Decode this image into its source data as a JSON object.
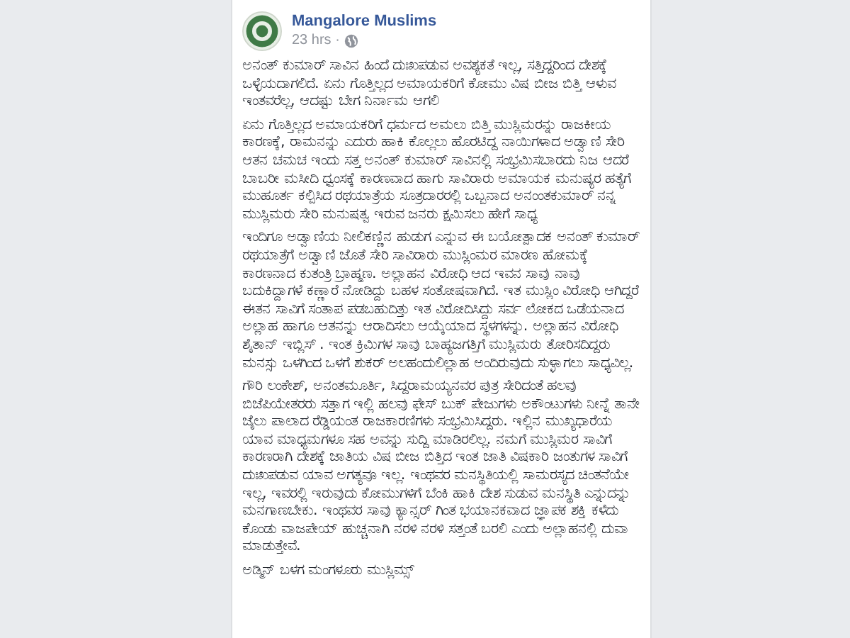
{
  "post": {
    "author": "Mangalore Muslims",
    "time": "23 hrs ·",
    "paragraphs": [
      "ಅನಂತ್ ಕುಮಾರ್ ಸಾವಿನ ಹಿಂದೆ ದುಃಖಪಡುವ ಅವಶ್ಯಕತೆ ಇಲ್ಲ, ಸತ್ತಿದ್ದರಿಂದ ದೇಶಕ್ಕೆ ಒಳ್ಳೆಯದಾಗಲಿದೆ. ಏನು ಗೊತ್ತಿಲ್ಲದ ಅಮಾಯಕರಿಗೆ ಕೋಮು ವಿಷ ಬೀಜ ಬಿತ್ತಿ ಆಳುವ ಇಂತವರೆಲ್ಲ, ಆದಷ್ಟು ಬೇಗ ನಿರ್ನಾಮ ಆಗಲಿ",
      "ಏನು ಗೊತ್ತಿಲ್ಲದ ಅಮಾಯಕರಿಗೆ ಧರ್ಮದ ಅಮಲು ಬಿತ್ತಿ ಮುಸ್ಲಿಮರನ್ನು ರಾಜಕೀಯ ಕಾರಣಕ್ಕೆ, ರಾಮನನ್ನು ಎದುರು ಹಾಕಿ ಕೊಲ್ಲಲು ಹೊರಟಿದ್ದ ನಾಯಿಗಳಾದ ಅಡ್ವಾಣಿ ಸೇರಿ ಆತನ ಚಮಚ ಇಂದು ಸತ್ತ ಅನಂತ್ ಕುಮಾರ್ ಸಾವಿನಲ್ಲಿ ಸಂಭ್ರಮಿಸಬಾರದು ನಿಜ ಆದರೆ ಬಾಬರೀ ಮಸೀದಿ ಧ್ವಂಸಕ್ಕೆ ಕಾರಣವಾದ ಹಾಗು ಸಾವಿರಾರು ಅಮಾಯಕ ಮನುಷ್ಯರ ಹತ್ಯೆಗೆ ಮುಹೂರ್ತ ಕಲ್ಪಿಸಿದ ರಥಯಾತ್ರೆಯ ಸೂತ್ರದಾರರಲ್ಲಿ ಒಬ್ಬನಾದ ಅನಂಂತಕುಮಾರ್ ನನ್ನ ಮುಸ್ಲಿಮರು ಸೇರಿ ಮನುಷತ್ವ ಇರುವ ಜನರು ಕ್ಷಮಿಸಲು ಹೇಗೆ ಸಾಧ್ಯ",
      "ಇಂದಿಗೂ ಅಡ್ವಾಣಿಯ ನೀಲಿಕಣ್ಣಿನ ಹುಡುಗ ಎನ್ನುವ ಈ ಬಯೋತ್ಪಾದಕ ಅನಂತ್ ಕುಮಾರ್ ರಥಯಾತ್ರೆಗೆ ಅಡ್ವಾಣಿ ಜೊತೆ ಸೇರಿ ಸಾವಿರಾರು ಮುಸ್ಲಿಂಮರ ಮಾರಣ ಹೋಮಕ್ಕೆ ಕಾರಣನಾದ ಕುತಂತ್ರಿ ಬ್ರಾಹ್ಮಣ. ಅಲ್ಲಾಹನ ವಿರೋಧಿ ಆದ ಇವನ ಸಾವು ನಾವು ಬದುಕಿದ್ದಾಗಳೆ ಕಣ್ಣಾರೆ ನೋಡಿದ್ದು ಬಹಳ ಸಂತೋಷವಾಗಿದೆ. ಇತ ಮುಸ್ಲಿಂ ವಿರೋಧಿ ಆಗಿದ್ದರೆ ಈತನ ಸಾವಿಗೆ ಸಂತಾಪ ಪಡಬಹುದಿತ್ತು ಇತ ವಿರೋದಿಸಿದ್ದು ಸರ್ವ ಲೋಕದ ಒಡೆಯನಾದ ಅಲ್ಲಾಹ ಹಾಗೂ ಆತನನ್ನು ಆರಾದಿಸಲು ಆಯ್ಕೆಯಾದ ಸ್ಥಳಗಳನ್ನು. ಅಲ್ಲಾಹನ ವಿರೋಧಿ ಶೈತಾನ್ ಇಬ್ಲಿಸ್ . ಇಂತ ಕ್ರಿಮಿಗಳ ಸಾವು ಬಾಹ್ಯಜಗತ್ತಿಗೆ ಮುಸ್ಲಿಮರು ತೋರಿಸದಿದ್ದರು ಮನಸ್ಸು ಒಳಗಿಂದ ಒಳಗೆ ಶುಕರ್ ಅಲಹಂದುಲಿಲ್ಲಾಹ ಅಂದಿರುವುದು ಸುಳ್ಳಾಗಲು ಸಾಧ್ಯವಿಲ್ಲ.",
      "ಗೌರಿ ಲಂಕೇಶ್, ಅನಂತಮೂರ್ತಿ, ಸಿದ್ದರಾಮಯ್ಯನವರ ಪುತ್ರ ಸೇರಿದಂತೆ ಹಲವು ಬಿಜೆಪಿಯೇತರರು ಸತ್ತಾಗ ಇಲ್ಲಿ ಹಲವು ಫೇಸ್ ಬುಕ್ ಪೇಜುಗಳು ಅಕೌಂಟುಗಳು ನೀನ್ನೆ ತಾನೇ ಜೈಲು ಪಾಲಾದ ರೆಡ್ಡಿಯಂತ ರಾಜಕಾರಣಿಗಳು ಸಂಭ್ರಮಿಸಿದ್ದರು. ಇಲ್ಲಿನ ಮುಖ್ಯಧಾರೆಯ ಯಾವ ಮಾಧ್ಯಮಗಳೂ ಸಹ ಅವನ್ನು ಸುದ್ದಿ ಮಾಡಿರಲಿಲ್ಲ. ನಮಗೆ ಮುಸ್ಲಿಮರ ಸಾವಿಗೆ ಕಾರಣರಾಗಿ ದೇಶಕ್ಕೆ ಜಾತಿಯ ವಿಷ ಬೀಜ ಬಿತ್ತಿದ ಇಂತ ಜಾತಿ ವಿಷಕಾರಿ ಜಂತುಗಳ ಸಾವಿಗೆ ದುಃಖಪಡುವ ಯಾವ ಅಗತ್ಯವೂ ಇಲ್ಲ. ಇಂಥವರ ಮನಸ್ಥಿತಿಯಲ್ಲಿ ಸಾಮರಸ್ಯದ ಚಿಂತನೆಯೇ ಇಲ್ಲ, ಇವರಲ್ಲಿ ಇರುವುದು ಕೋಮುಗಳಿಗೆ ಬೆಂಕಿ ಹಾಕಿ ದೇಶ ಸುಡುವ ಮನಸ್ಥಿತಿ ಎನ್ನುದನ್ನು ಮನಗಾಣಬೇಕು. ಇಂಥವರ ಸಾವು ಕ್ಯಾನ್ಸರ್ ಗಿಂತ ಭಯಾನಕವಾದ ಜ್ಞಾಪಕ ಶಕ್ತಿ ಕಳೆದು ಕೊಂಡು ವಾಜಪೇಯ್ ಹುಚ್ಚನಾಗಿ ನರಳಿ ನರಳಿ ಸತ್ತಂತೆ ಬರಲಿ ಎಂದು ಅಲ್ಲಾಹನಲ್ಲಿ ದುವಾ ಮಾಡುತ್ತೇವೆ.",
      "ಅಡ್ಮಿನ್ ಬಳಗ ಮಂಗಳೂರು ಮುಸ್ಲಿಮ್ಸ್"
    ]
  }
}
